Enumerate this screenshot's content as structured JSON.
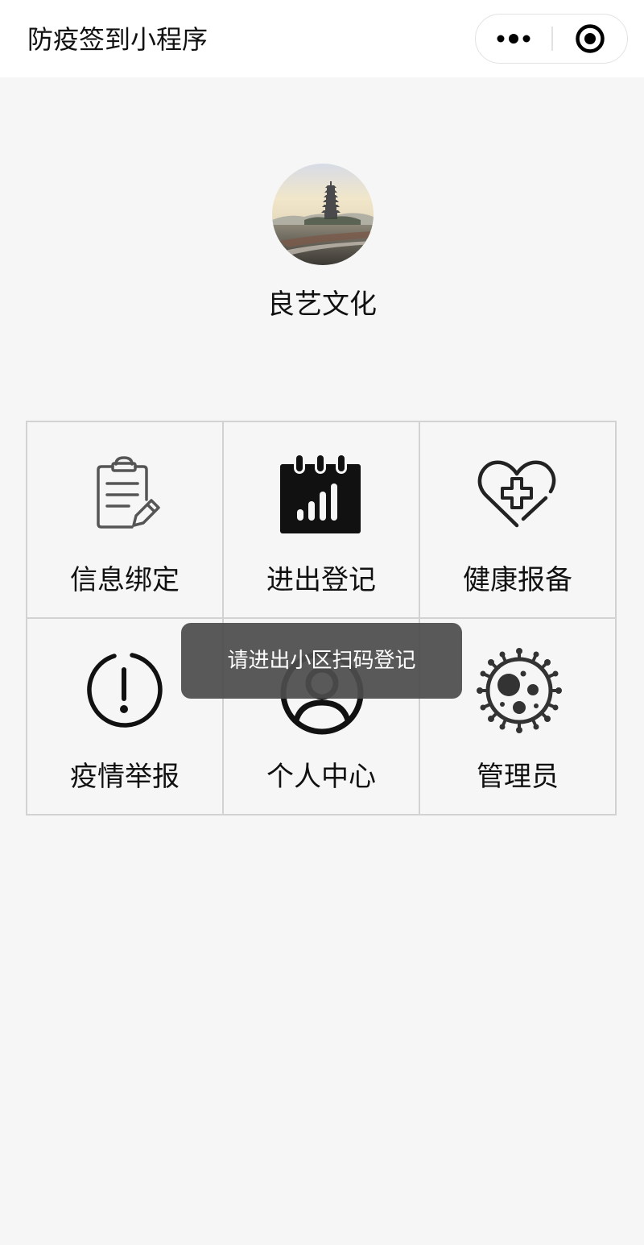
{
  "navbar": {
    "title": "防疫签到小程序",
    "more_icon": "more-dots-icon",
    "close_icon": "target-close-icon"
  },
  "profile": {
    "avatar": "pagoda-landscape-avatar",
    "name": "良艺文化"
  },
  "menu": {
    "items": [
      {
        "label": "信息绑定",
        "icon": "clipboard-edit-icon"
      },
      {
        "label": "进出登记",
        "icon": "calendar-chart-icon"
      },
      {
        "label": "健康报备",
        "icon": "heart-plus-icon"
      },
      {
        "label": "疫情举报",
        "icon": "alert-circle-icon"
      },
      {
        "label": "个人中心",
        "icon": "user-circle-icon"
      },
      {
        "label": "管理员",
        "icon": "virus-icon"
      }
    ]
  },
  "toast": {
    "message": "请进出小区扫码登记"
  },
  "colors": {
    "background": "#f6f6f6",
    "navbar": "#ffffff",
    "grid_border": "#d2d2d2",
    "icon_dark": "#111111",
    "icon_gray": "#555555",
    "toast_bg": "#4c4c4c"
  }
}
